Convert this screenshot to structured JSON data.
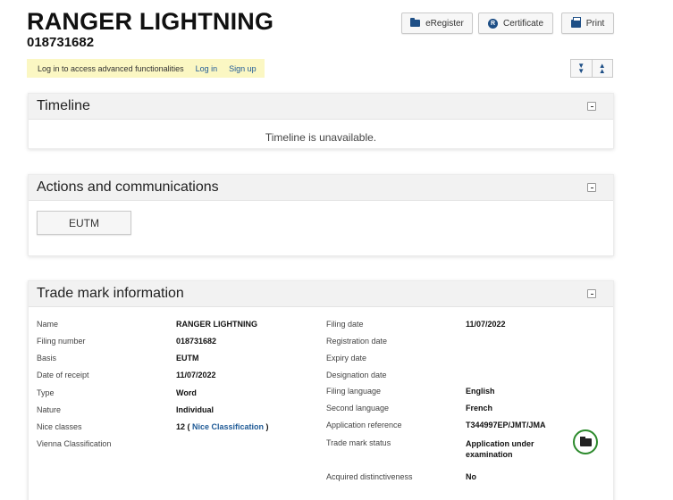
{
  "header": {
    "title": "RANGER LIGHTNING",
    "filing_number": "018731682",
    "buttons": {
      "eregister": "eRegister",
      "certificate": "Certificate",
      "print": "Print"
    },
    "certificate_icon_letter": "R"
  },
  "login_bar": {
    "message": "Log in to access advanced functionalities",
    "login": "Log in",
    "signup": "Sign up"
  },
  "timeline": {
    "title": "Timeline",
    "message": "Timeline is unavailable."
  },
  "actions": {
    "title": "Actions and communications",
    "eutm_button": "EUTM"
  },
  "trade_mark_info": {
    "title": "Trade mark information",
    "left": [
      {
        "label": "Name",
        "value": "RANGER LIGHTNING"
      },
      {
        "label": "Filing number",
        "value": "018731682"
      },
      {
        "label": "Basis",
        "value": "EUTM"
      },
      {
        "label": "Date of receipt",
        "value": "11/07/2022"
      },
      {
        "label": "Type",
        "value": "Word"
      },
      {
        "label": "Nature",
        "value": "Individual"
      },
      {
        "label": "Nice classes",
        "value_prefix": "12 ( ",
        "link": "Nice Classification",
        "value_suffix": " )"
      },
      {
        "label": "Vienna Classification",
        "value": ""
      }
    ],
    "right": [
      {
        "label": "Filing date",
        "value": "11/07/2022"
      },
      {
        "label": "Registration date",
        "value": ""
      },
      {
        "label": "Expiry date",
        "value": ""
      },
      {
        "label": "Designation date",
        "value": ""
      },
      {
        "label": "Filing language",
        "value": "English"
      },
      {
        "label": "Second language",
        "value": "French"
      },
      {
        "label": "Application reference",
        "value": "T344997EP/JMT/JMA"
      },
      {
        "label": "Trade mark status",
        "value": "Application under examination"
      },
      {
        "label": "Acquired distinctiveness",
        "value": "No"
      }
    ],
    "status_icon": "folder-status-icon",
    "status_color": "#2c8a2c"
  },
  "colors": {
    "link": "#1f5a96",
    "login_bar_bg": "#fbf7c3",
    "icon_blue": "#1e4f86"
  }
}
